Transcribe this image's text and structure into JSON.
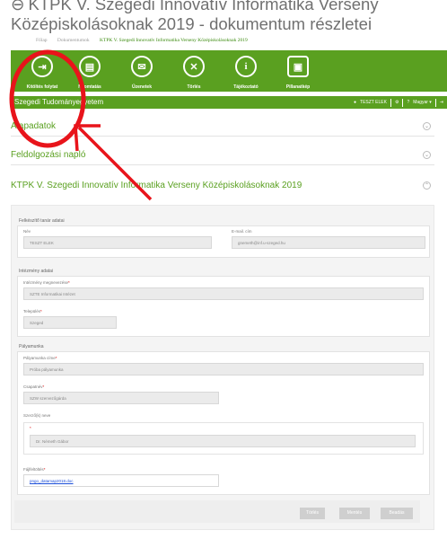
{
  "title": {
    "back_glyph": "⊖",
    "text": "KTPK V. Szegedi Innovatív Informatika Verseny Középiskolásoknak 2019 - dokumentum részletei"
  },
  "breadcrumb": [
    "Főlap",
    "Dokumentumok",
    "KTPK V. Szegedi Innovatív Informatika Verseny Középiskolásoknak 2019"
  ],
  "toolbar": [
    {
      "glyph": "⇥",
      "label": "Kitöltés folytat"
    },
    {
      "glyph": "▤",
      "label": "Nyomtatás"
    },
    {
      "glyph": "✉",
      "label": "Üzenetek"
    },
    {
      "glyph": "✕",
      "label": "Törlés"
    },
    {
      "glyph": "i",
      "label": "Tájékoztató"
    },
    {
      "glyph": "▣",
      "label": "Pillanatkép"
    }
  ],
  "appbar": {
    "org": "Szegedi Tudományegyetem",
    "user": "TESZT ELEK",
    "lang": "Magyar ▾"
  },
  "sections": {
    "alapadatok": "Alapadatok",
    "naplo": "Feldolgozási napló",
    "doc": "KTPK V. Szegedi Innovatív Informatika Verseny Középiskolásoknak 2019"
  },
  "teacher": {
    "heading": "Felkészítő tanár adatai",
    "name_label": "Név",
    "name_value": "TESZT ELEK",
    "email_label": "E-mail. cím",
    "email_value": "gnemeth@inf.u-szeged.hu"
  },
  "institution": {
    "heading": "Intézmény adatai",
    "name_label": "Intézmény megnevezése",
    "name_value": "SZTE Informatikai Intézet",
    "city_label": "Település",
    "city_value": "Szeged"
  },
  "work": {
    "heading": "Pályamunka",
    "title_label": "Pályamunka címe",
    "title_value": "Próba pályamunka",
    "team_label": "Csapatnév",
    "team_value": "SZW szervezőgárda",
    "author_heading": "Szerző(k) neve",
    "author_value": "Dr. Németh Gábor",
    "file_label": "Fájlfeltöltés",
    "file_value": "pngo_datamap2018.doc"
  },
  "footer": {
    "delete": "Törlés",
    "save": "Mentés",
    "submit": "Beadás"
  }
}
